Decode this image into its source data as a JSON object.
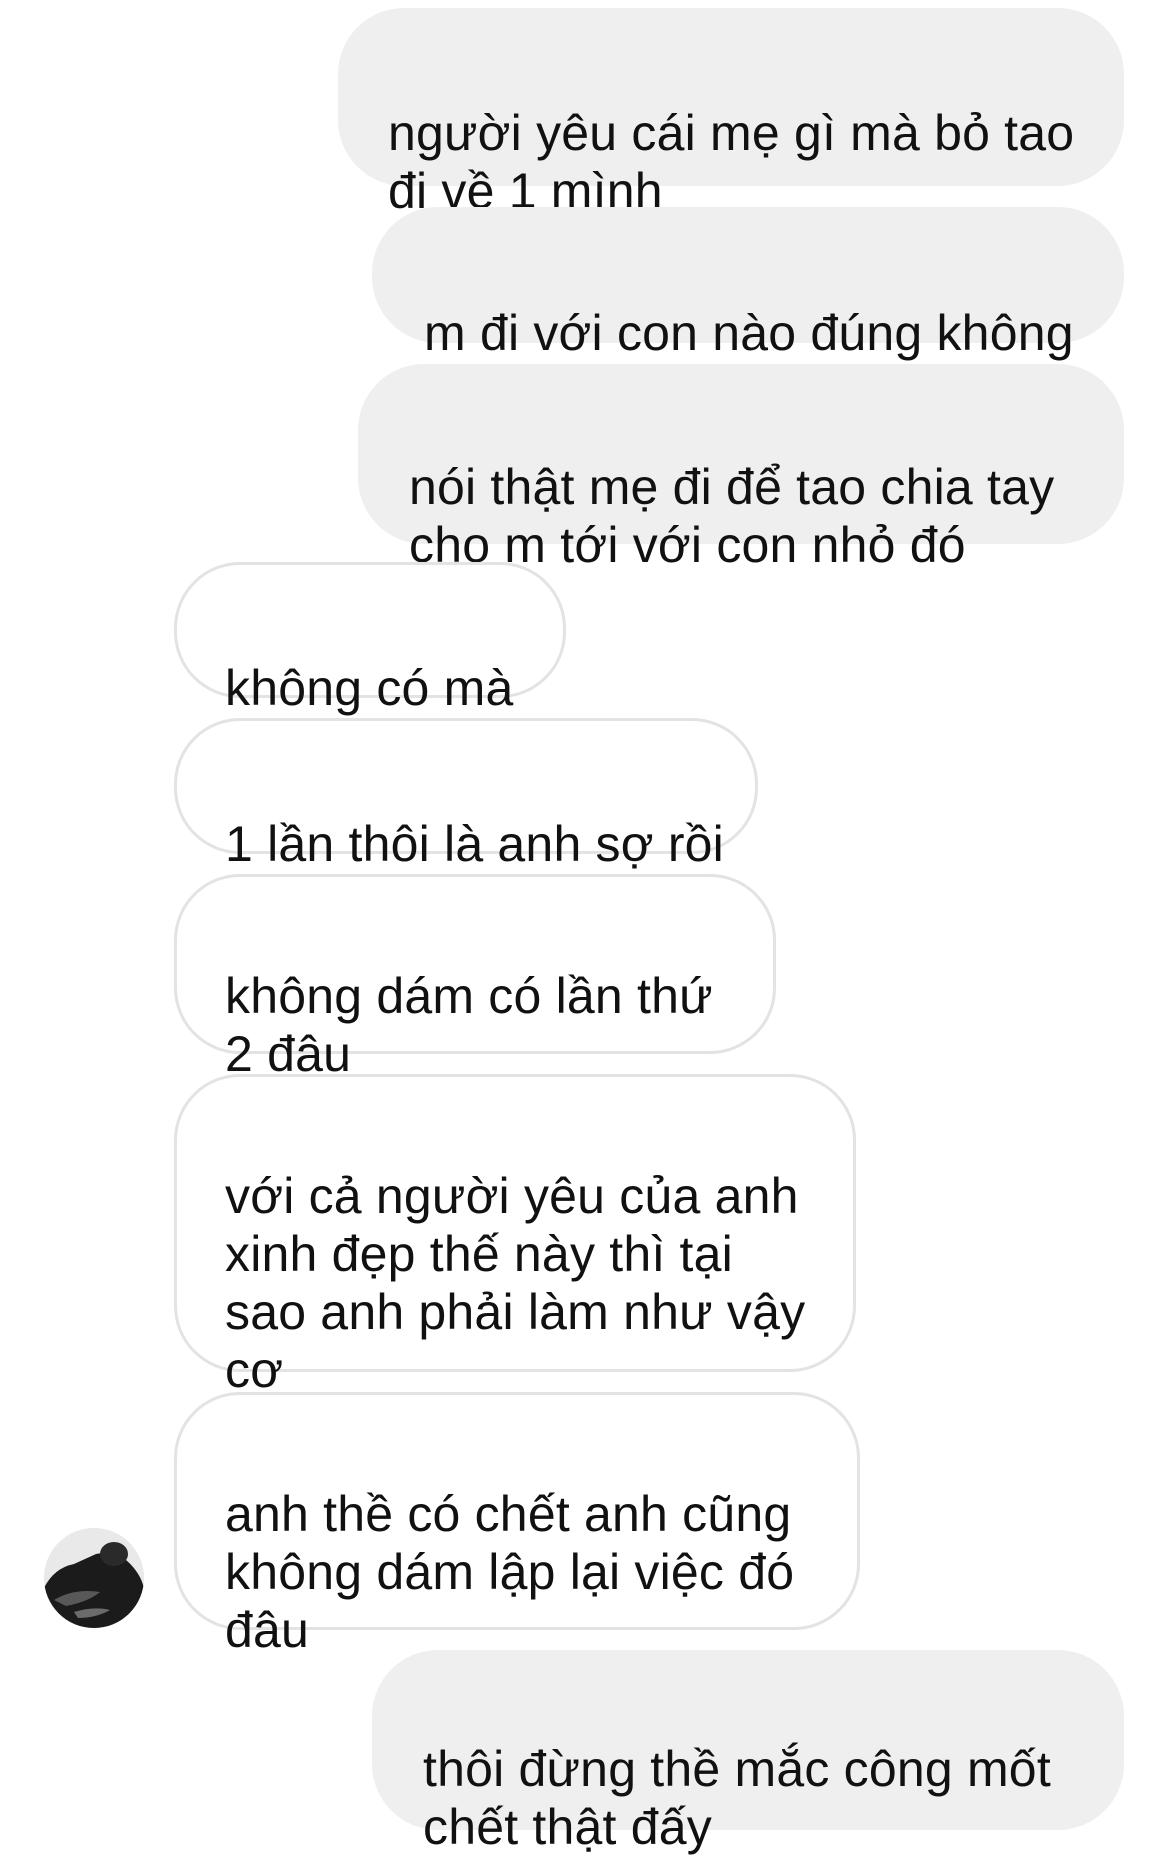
{
  "conversation": {
    "messages": [
      {
        "from": "me",
        "text": "người yêu cái mẹ gì mà bỏ tao\nđi về 1 mình"
      },
      {
        "from": "me",
        "text": "m đi với con nào đúng không"
      },
      {
        "from": "me",
        "text": "nói thật mẹ đi để tao chia tay\ncho m tới với con nhỏ đó"
      },
      {
        "from": "them",
        "text": "không có mà"
      },
      {
        "from": "them",
        "text": "1 lần thôi là anh sợ rồi"
      },
      {
        "from": "them",
        "text": "không dám có lần thứ\n2 đâu"
      },
      {
        "from": "them",
        "text": "với cả người yêu của anh\nxinh đẹp thế này thì tại\nsao anh phải làm như vậy\ncơ"
      },
      {
        "from": "them",
        "text": "anh thề có chết anh cũng\nkhông dám lập lại việc đó\nđâu"
      },
      {
        "from": "me",
        "text": "thôi đừng thề mắc công mốt\nchết thật đấy"
      }
    ],
    "contact_avatar_icon": "profile-photo-avatar"
  }
}
